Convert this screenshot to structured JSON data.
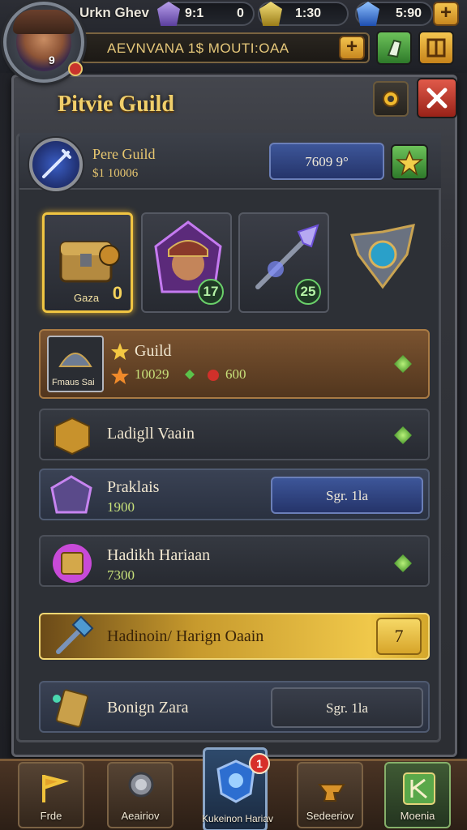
{
  "player": {
    "name": "Urkn Ghev",
    "level": "9"
  },
  "currencies": [
    {
      "name": "crystal",
      "value": "9:1",
      "secondary": "0",
      "color": "#8a6fc9"
    },
    {
      "name": "gold-gem",
      "value": "1:30",
      "color": "#e0c23a"
    },
    {
      "name": "sapphire",
      "value": "5:90",
      "color": "#3a7be0"
    }
  ],
  "banner": {
    "message": "AEVNVANA 1$ MOUTI:OAA"
  },
  "panel": {
    "title": "Pitvie Guild"
  },
  "guild": {
    "name": "Pere Guild",
    "gold": "$1 10006",
    "field_value": "7609 9°"
  },
  "slots": [
    {
      "label": "Gaza",
      "count": "0",
      "selected": true
    },
    {
      "count": "17",
      "selected": false
    },
    {
      "count": "25",
      "selected": false
    },
    {
      "selected": false
    }
  ],
  "rows": [
    {
      "id": "guild",
      "name": "Guild",
      "caption": "Fmaus Sai",
      "stat_a": "10029",
      "stat_b": "600",
      "style": "bronze"
    },
    {
      "id": "vaain",
      "name": "Ladigll Vaain",
      "style": "dark"
    },
    {
      "id": "praklais",
      "name": "Praklais",
      "value": "1900",
      "action": "Sgr. 1la",
      "style": "blue"
    },
    {
      "id": "hadikh",
      "name": "Hadikh Hariaan",
      "value": "7300",
      "style": "dark"
    },
    {
      "id": "hadinoin",
      "name": "Hadinoin/ Harign Oaain",
      "badge": "7",
      "style": "gold"
    },
    {
      "id": "bonign",
      "name": "Bonign Zara",
      "action": "Sgr. 1la",
      "style": "blue"
    }
  ],
  "nav": [
    {
      "label": "Frde"
    },
    {
      "label": "Aeairiov"
    },
    {
      "label": "Kukeinon Hariav",
      "badge": "1",
      "active": true
    },
    {
      "label": "Sedeeriov"
    },
    {
      "label": "Moenia"
    }
  ]
}
